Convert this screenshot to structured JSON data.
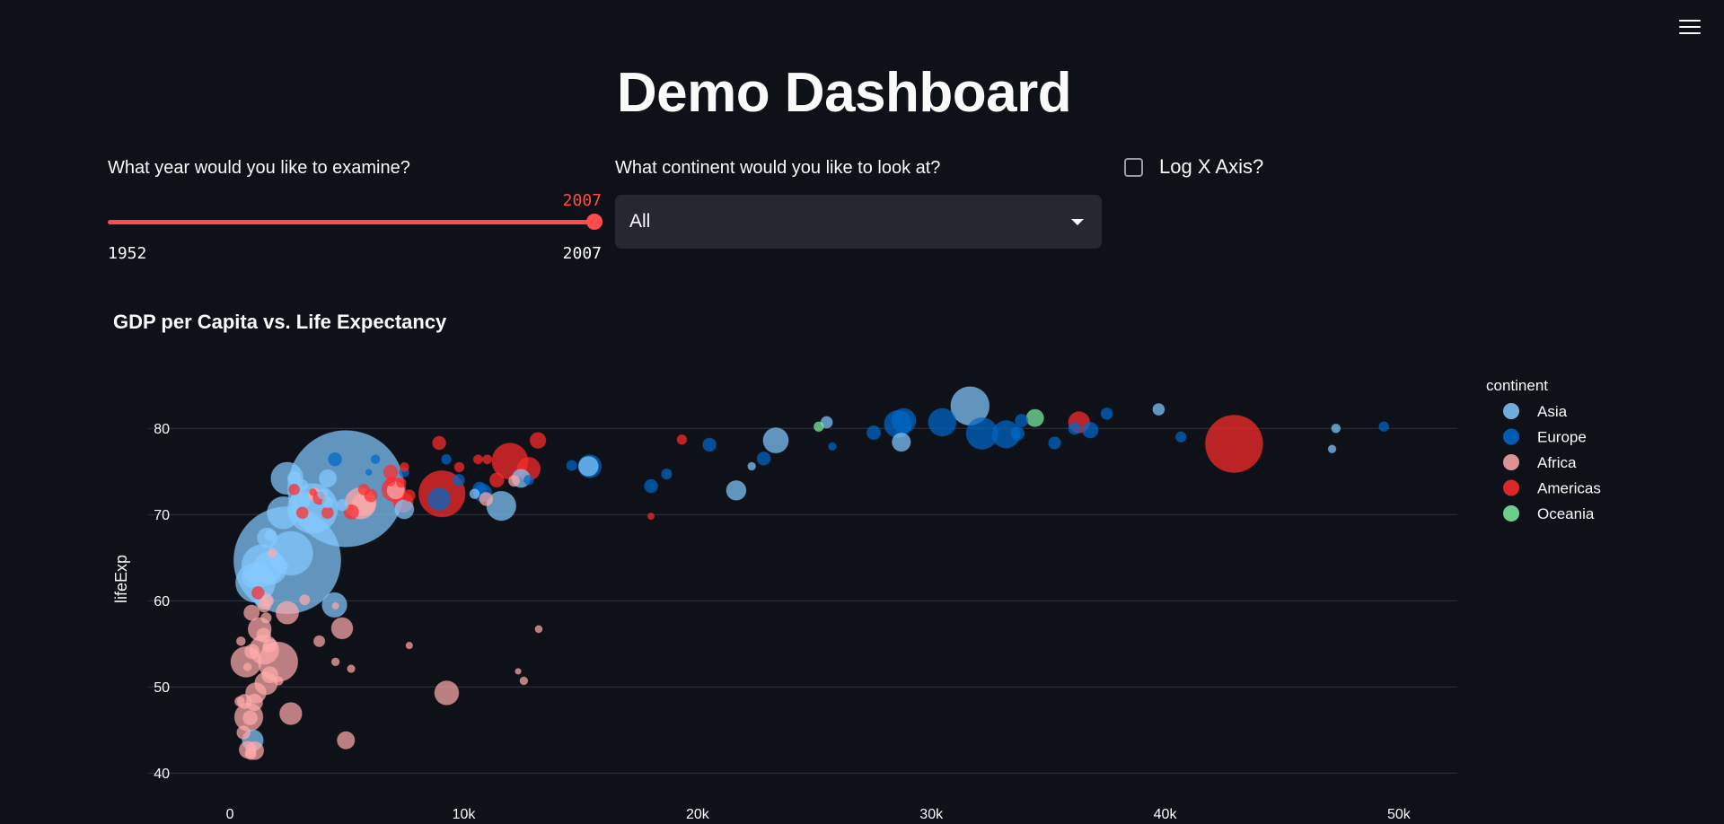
{
  "header": {
    "title": "Demo Dashboard",
    "menu_icon": "hamburger-menu-icon"
  },
  "controls": {
    "year_slider": {
      "label": "What year would you like to examine?",
      "value": "2007",
      "min": "1952",
      "max": "2007",
      "fraction": 1.0
    },
    "continent_select": {
      "label": "What continent would you like to look at?",
      "value": "All"
    },
    "log_checkbox": {
      "label": "Log X Axis?",
      "checked": false
    }
  },
  "colors": {
    "background": "#0e1117",
    "accent": "#ff4b4b",
    "Asia": "#83c9ff",
    "Europe": "#0068c9",
    "Africa": "#ffabab",
    "Americas": "#ff2b2b",
    "Oceania": "#7defa1"
  },
  "chart_data": {
    "type": "scatter",
    "title": "GDP per Capita vs. Life Expectancy",
    "xlabel": "",
    "ylabel": "lifeExp",
    "xlim": [
      -3500,
      52500
    ],
    "ylim": [
      37,
      87
    ],
    "x_ticks": [
      0,
      10000,
      20000,
      30000,
      40000,
      50000
    ],
    "x_tick_labels": [
      "0",
      "10k",
      "20k",
      "30k",
      "40k",
      "50k"
    ],
    "y_ticks": [
      40,
      50,
      60,
      70,
      80
    ],
    "y_tick_labels": [
      "40",
      "50",
      "60",
      "70",
      "80"
    ],
    "grid": "horizontal",
    "legend_title": "continent",
    "legend_position": "right",
    "series": [
      {
        "name": "Asia",
        "points": [
          [
            4959,
            73.0,
            1318
          ],
          [
            2452,
            64.7,
            1110
          ],
          [
            3541,
            70.7,
            223
          ],
          [
            2605,
            65.5,
            169
          ],
          [
            31656,
            82.6,
            127
          ],
          [
            1391,
            64.1,
            150
          ],
          [
            1091,
            62.1,
            135
          ],
          [
            2281,
            70.2,
            86
          ],
          [
            1714,
            63.8,
            92
          ],
          [
            11606,
            71.0,
            69
          ],
          [
            4471,
            59.5,
            47
          ],
          [
            2442,
            74.2,
            85
          ],
          [
            23348,
            78.6,
            49
          ],
          [
            28718,
            78.4,
            23
          ],
          [
            974,
            43.8,
            32
          ],
          [
            15334,
            75.6,
            27
          ],
          [
            4185,
            74.2,
            20
          ],
          [
            3025,
            71.7,
            27
          ],
          [
            7458,
            70.6,
            25
          ],
          [
            21655,
            72.8,
            27
          ],
          [
            1594,
            67.3,
            28
          ],
          [
            944,
            62.7,
            28
          ],
          [
            12452,
            74.2,
            23
          ],
          [
            39724,
            82.2,
            7
          ],
          [
            25523,
            80.7,
            7
          ],
          [
            47307,
            80.0,
            3
          ],
          [
            47143,
            77.6,
            2
          ],
          [
            22316,
            75.6,
            2
          ],
          [
            2749,
            74.2,
            10
          ],
          [
            3095,
            73.4,
            6
          ],
          [
            10461,
            72.4,
            4
          ],
          [
            1713,
            67.6,
            6
          ],
          [
            4173,
            71.4,
            6
          ],
          [
            3970,
            72.4,
            5
          ],
          [
            1442,
            60.0,
            20
          ],
          [
            2280,
            64.1,
            4
          ],
          [
            4811,
            71.1,
            7
          ]
        ]
      },
      {
        "name": "Europe",
        "points": [
          [
            32170,
            79.4,
            82
          ],
          [
            30470,
            80.7,
            61
          ],
          [
            28570,
            80.5,
            58
          ],
          [
            33203,
            79.3,
            60
          ],
          [
            28821,
            80.9,
            45
          ],
          [
            8948,
            71.8,
            38
          ],
          [
            15390,
            75.6,
            40
          ],
          [
            10808,
            72.5,
            22
          ],
          [
            36797,
            79.8,
            16
          ],
          [
            33692,
            79.4,
            10
          ],
          [
            35278,
            78.3,
            8
          ],
          [
            27538,
            79.5,
            11
          ],
          [
            33860,
            80.9,
            9
          ],
          [
            37506,
            81.7,
            7
          ],
          [
            49357,
            80.2,
            4
          ],
          [
            40676,
            79.0,
            5
          ],
          [
            36126,
            80.0,
            8
          ],
          [
            18009,
            73.3,
            10
          ],
          [
            20510,
            78.1,
            10
          ],
          [
            22833,
            76.5,
            10
          ],
          [
            14619,
            75.7,
            5
          ],
          [
            12779,
            74.0,
            4
          ],
          [
            18678,
            74.7,
            5
          ],
          [
            10680,
            73.0,
            10
          ],
          [
            9787,
            74.0,
            7
          ],
          [
            7446,
            74.9,
            4
          ],
          [
            9254,
            76.4,
            4
          ],
          [
            6223,
            76.4,
            3
          ],
          [
            5937,
            74.9,
            0.7
          ],
          [
            25768,
            77.9,
            2
          ],
          [
            4492,
            76.4,
            10
          ]
        ]
      },
      {
        "name": "Africa",
        "points": [
          [
            2055,
            52.9,
            135
          ],
          [
            690,
            52.9,
            76
          ],
          [
            1463,
            54.3,
            69
          ],
          [
            5581,
            71.3,
            80
          ],
          [
            9270,
            49.3,
            44
          ],
          [
            2452,
            58.6,
            38
          ],
          [
            1544,
            50.4,
            38
          ],
          [
            803,
            46.5,
            64
          ],
          [
            1107,
            49.3,
            30
          ],
          [
            2602,
            46.9,
            36
          ],
          [
            1271,
            56.7,
            40
          ],
          [
            4797,
            56.8,
            33
          ],
          [
            5728,
            71.2,
            40
          ],
          [
            1057,
            42.6,
            22
          ],
          [
            10957,
            71.8,
            10
          ],
          [
            4959,
            43.8,
            20
          ],
          [
            12154,
            73.9,
            6
          ],
          [
            13206,
            56.7,
            1.5
          ],
          [
            7093,
            72.8,
            20
          ],
          [
            3632,
            72.3,
            10
          ],
          [
            12570,
            50.7,
            2
          ],
          [
            1598,
            60.0,
            8
          ],
          [
            1704,
            51.4,
            17
          ],
          [
            759,
            42.7,
            19
          ],
          [
            1042,
            48.2,
            18
          ],
          [
            4513,
            52.9,
            2
          ],
          [
            1441,
            56.0,
            12
          ],
          [
            926,
            58.6,
            15
          ],
          [
            862,
            46.4,
            12
          ],
          [
            620,
            48.3,
            12
          ],
          [
            943,
            54.1,
            13
          ],
          [
            1463,
            59.4,
            9
          ],
          [
            3820,
            55.3,
            6
          ],
          [
            1545,
            58.0,
            5
          ],
          [
            579,
            44.7,
            10
          ],
          [
            2082,
            50.7,
            3
          ],
          [
            1807,
            65.5,
            3
          ],
          [
            5182,
            52.1,
            1.9
          ],
          [
            4513,
            59.4,
            1
          ],
          [
            883,
            42.2,
            6
          ],
          [
            415,
            48.3,
            4
          ],
          [
            469,
            55.3,
            3
          ],
          [
            1569,
            54.5,
            2.5
          ],
          [
            7670,
            54.8,
            1.1
          ],
          [
            12326,
            51.8,
            0.6
          ],
          [
            753,
            52.3,
            2
          ],
          [
            1713,
            54.8,
            10
          ],
          [
            3193,
            60.1,
            4.6
          ]
        ]
      },
      {
        "name": "Americas",
        "points": [
          [
            42952,
            78.2,
            301
          ],
          [
            9066,
            72.4,
            190
          ],
          [
            11977,
            76.2,
            109
          ],
          [
            7007,
            72.9,
            44
          ],
          [
            12779,
            75.3,
            40
          ],
          [
            36319,
            80.7,
            33
          ],
          [
            7409,
            71.4,
            28
          ],
          [
            13172,
            78.6,
            16
          ],
          [
            11416,
            74.0,
            12
          ],
          [
            6873,
            74.9,
            12
          ],
          [
            5186,
            70.3,
            13
          ],
          [
            6025,
            72.2,
            9
          ],
          [
            3822,
            71.9,
            9
          ],
          [
            7670,
            72.2,
            7
          ],
          [
            4173,
            70.2,
            7
          ],
          [
            5728,
            72.9,
            6
          ],
          [
            2749,
            72.9,
            5.5
          ],
          [
            9809,
            75.5,
            4
          ],
          [
            3548,
            72.6,
            1.2
          ],
          [
            8948,
            78.3,
            10
          ],
          [
            1202,
            60.9,
            8.5
          ],
          [
            10611,
            76.4,
            3.4
          ],
          [
            18009,
            69.8,
            1
          ],
          [
            7321,
            73.7,
            4
          ],
          [
            19329,
            78.7,
            4
          ],
          [
            7460,
            75.5,
            3.2
          ],
          [
            11003,
            76.4,
            3.4
          ],
          [
            6873,
            73.8,
            3
          ],
          [
            3095,
            70.2,
            7
          ]
        ]
      },
      {
        "name": "Oceania",
        "points": [
          [
            34435,
            81.2,
            20
          ],
          [
            25185,
            80.2,
            4
          ]
        ]
      }
    ]
  }
}
